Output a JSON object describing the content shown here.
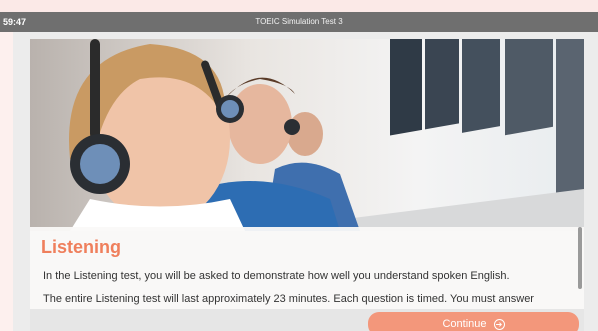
{
  "header": {
    "timer": "59:47",
    "title": "TOEIC Simulation Test 3"
  },
  "section": {
    "heading": "Listening",
    "paragraphs": [
      "In the Listening test, you will be asked to demonstrate how well you understand spoken English.",
      "The entire Listening test will last approximately 23 minutes. Each question is timed. You must answer"
    ]
  },
  "footer": {
    "continue_label": "Continue",
    "continue_icon": "arrow-right-circle-icon"
  },
  "colors": {
    "accent": "#ef7f5c",
    "button": "#f3977b",
    "titlebar": "#6f6f6f"
  }
}
